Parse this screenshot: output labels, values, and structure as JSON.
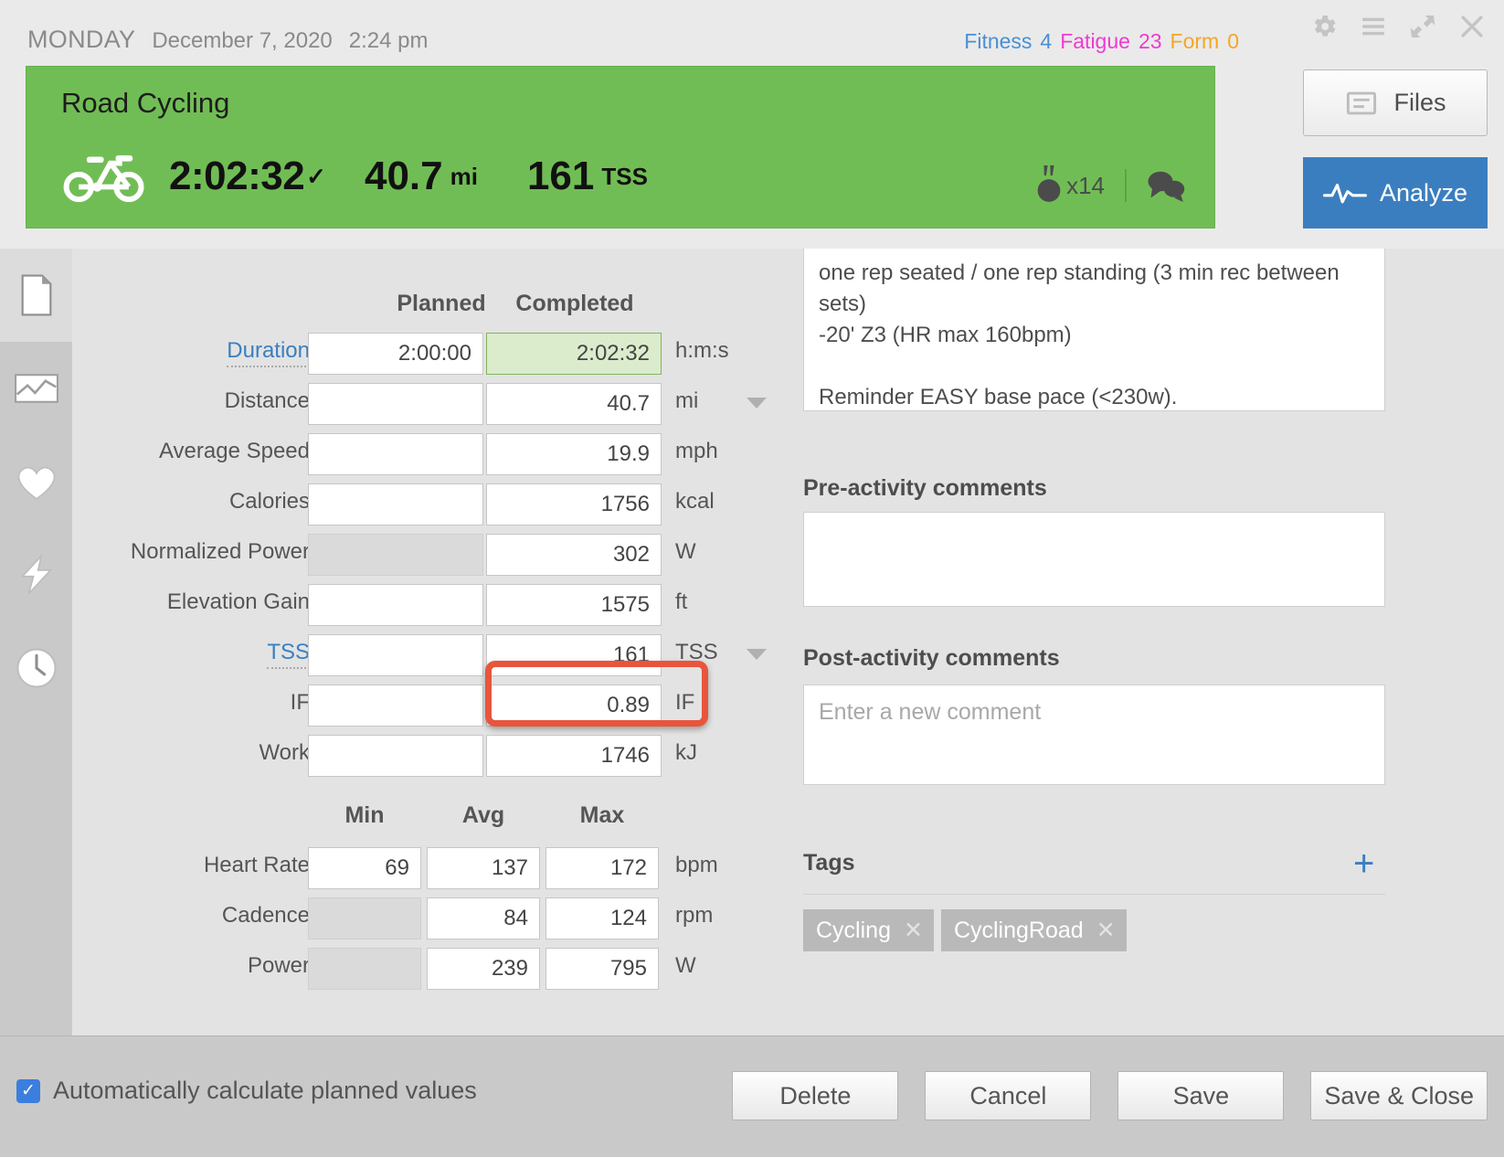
{
  "header": {
    "weekday": "MONDAY",
    "date": "December 7, 2020",
    "time": "2:24 pm",
    "pmc": {
      "fitness_label": "Fitness",
      "fitness_value": "4",
      "fatigue_label": "Fatigue",
      "fatigue_value": "23",
      "form_label": "Form",
      "form_value": "0",
      "fitness_color": "#4a8fd4",
      "fatigue_color": "#ef3ad0",
      "form_color": "#f5a623"
    },
    "window_icons": [
      "gear-icon",
      "menu-icon",
      "expand-icon",
      "close-icon"
    ]
  },
  "activity": {
    "title": "Road Cycling",
    "sport_icon": "bicycle-icon",
    "duration": "2:02:32",
    "completed_check": "✓",
    "distance": "40.7",
    "distance_unit": "mi",
    "tss": "161",
    "tss_unit": "TSS",
    "medal_count": "x14",
    "medal_icon": "medal-icon",
    "comments_icon": "comments-icon",
    "banner_color": "#71bd55"
  },
  "actions": {
    "files_label": "Files",
    "files_icon": "files-icon",
    "analyze_label": "Analyze",
    "analyze_icon": "waveform-icon",
    "analyze_color": "#3b7ebf"
  },
  "sidebar": {
    "items": [
      {
        "icon": "document-icon",
        "active": true
      },
      {
        "icon": "chart-icon",
        "active": false
      },
      {
        "icon": "heart-icon",
        "active": false
      },
      {
        "icon": "lightning-icon",
        "active": false
      },
      {
        "icon": "clock-icon",
        "active": false
      }
    ]
  },
  "form": {
    "col_planned": "Planned",
    "col_completed": "Completed",
    "rows": [
      {
        "label": "Duration",
        "link": true,
        "planned": "2:00:00",
        "completed": "2:02:32",
        "unit": "h:m:s",
        "caret": false,
        "planned_disabled": false,
        "completed_highlight": true
      },
      {
        "label": "Distance",
        "link": false,
        "planned": "",
        "completed": "40.7",
        "unit": "mi",
        "caret": true,
        "planned_disabled": false,
        "completed_highlight": false
      },
      {
        "label": "Average Speed",
        "link": false,
        "planned": "",
        "completed": "19.9",
        "unit": "mph",
        "caret": false,
        "planned_disabled": false,
        "completed_highlight": false
      },
      {
        "label": "Calories",
        "link": false,
        "planned": "",
        "completed": "1756",
        "unit": "kcal",
        "caret": false,
        "planned_disabled": false,
        "completed_highlight": false
      },
      {
        "label": "Normalized Power",
        "link": false,
        "planned": "",
        "completed": "302",
        "unit": "W",
        "caret": false,
        "planned_disabled": true,
        "completed_highlight": false
      },
      {
        "label": "Elevation Gain",
        "link": false,
        "planned": "",
        "completed": "1575",
        "unit": "ft",
        "caret": false,
        "planned_disabled": false,
        "completed_highlight": false
      },
      {
        "label": "TSS",
        "link": true,
        "planned": "",
        "completed": "161",
        "unit": "TSS",
        "caret": true,
        "planned_disabled": false,
        "completed_highlight": false
      },
      {
        "label": "IF",
        "link": false,
        "planned": "",
        "completed": "0.89",
        "unit": "IF",
        "caret": false,
        "planned_disabled": false,
        "completed_highlight": false
      },
      {
        "label": "Work",
        "link": false,
        "planned": "",
        "completed": "1746",
        "unit": "kJ",
        "caret": false,
        "planned_disabled": false,
        "completed_highlight": false
      }
    ],
    "highlight_row": "IF",
    "highlight_color": "#e8553c"
  },
  "minavgmax": {
    "headers": [
      "Min",
      "Avg",
      "Max"
    ],
    "rows": [
      {
        "label": "Heart Rate",
        "values": [
          "69",
          "137",
          "172"
        ],
        "unit": "bpm",
        "disabled": [
          false,
          false,
          false
        ]
      },
      {
        "label": "Cadence",
        "values": [
          "",
          "84",
          "124"
        ],
        "unit": "rpm",
        "disabled": [
          true,
          false,
          false
        ]
      },
      {
        "label": "Power",
        "values": [
          "",
          "239",
          "795"
        ],
        "unit": "W",
        "disabled": [
          true,
          false,
          false
        ]
      }
    ]
  },
  "right_panel": {
    "description": "one rep seated / one rep standing (3 min rec between sets)\n-20' Z3 (HR max 160bpm)\n\nReminder EASY base pace (<230w).",
    "pre_activity_title": "Pre-activity comments",
    "pre_activity_value": "",
    "post_activity_title": "Post-activity comments",
    "post_activity_placeholder": "Enter a new comment",
    "tags_title": "Tags",
    "tags_add_icon": "plus-icon",
    "tags": [
      "Cycling",
      "CyclingRoad"
    ]
  },
  "footer": {
    "auto_calc_label": "Automatically calculate planned values",
    "auto_calc_checked": true,
    "buttons": [
      "Delete",
      "Cancel",
      "Save",
      "Save & Close"
    ]
  }
}
